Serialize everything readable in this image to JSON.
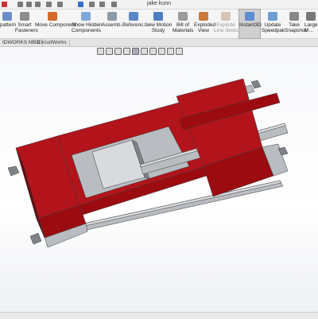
{
  "window": {
    "title": "jake kunn"
  },
  "ribbon": {
    "buttons": [
      {
        "id": "pattern",
        "line1": "pattern",
        "line2": ""
      },
      {
        "id": "smart-fasteners",
        "line1": "Smart",
        "line2": "Fasteners"
      },
      {
        "id": "move-component",
        "line1": "Move Component",
        "line2": ""
      },
      {
        "id": "show-hidden",
        "line1": "Show Hidden",
        "line2": "Components"
      },
      {
        "id": "assembly-features",
        "line1": "Assemb...",
        "line2": ""
      },
      {
        "id": "reference-geometry",
        "line1": "Referenc...",
        "line2": ""
      },
      {
        "id": "new-motion-study",
        "line1": "New Motion",
        "line2": "Study"
      },
      {
        "id": "bill-of-materials",
        "line1": "Bill of",
        "line2": "Materials"
      },
      {
        "id": "exploded-view",
        "line1": "Exploded",
        "line2": "View"
      },
      {
        "id": "explode-line-sketch",
        "line1": "Explode",
        "line2": "Line Sketch"
      },
      {
        "id": "instant3d",
        "line1": "Instant3D",
        "line2": ""
      },
      {
        "id": "update-speedpak",
        "line1": "Update",
        "line2": "Speedpak"
      },
      {
        "id": "take-snapshot",
        "line1": "Take",
        "line2": "Snapshot"
      },
      {
        "id": "large-assembly",
        "line1": "Large",
        "line2": "M..."
      }
    ]
  },
  "tabs": [
    {
      "label": "IDWORKS MBD"
    },
    {
      "label": "CircuitWorks"
    }
  ],
  "colors": {
    "part_red": "#9c0b10",
    "part_red_top": "#b3131a",
    "part_red_dark": "#6e070b",
    "steel": "#b9bcc0",
    "steel_light": "#d8dadd",
    "steel_dark": "#7e8288"
  }
}
